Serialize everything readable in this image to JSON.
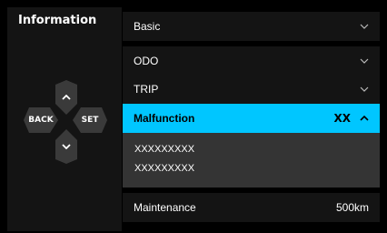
{
  "left": {
    "title": "Information",
    "dpad": {
      "up_icon": "chevron-up-icon",
      "down_icon": "chevron-down-icon",
      "back_label": "BACK",
      "set_label": "SET"
    }
  },
  "menu": {
    "rows": [
      {
        "label": "Basic"
      },
      {
        "label": "ODO"
      },
      {
        "label": "TRIP"
      }
    ],
    "active": {
      "label": "Malfunction",
      "value": "XX"
    },
    "submenu": [
      "XXXXXXXXX",
      "XXXXXXXXX"
    ],
    "maintenance": {
      "label": "Maintenance",
      "value": "500km"
    }
  },
  "colors": {
    "accent": "#00c6ff",
    "panel": "#141414",
    "submenu_bg": "#343434"
  }
}
